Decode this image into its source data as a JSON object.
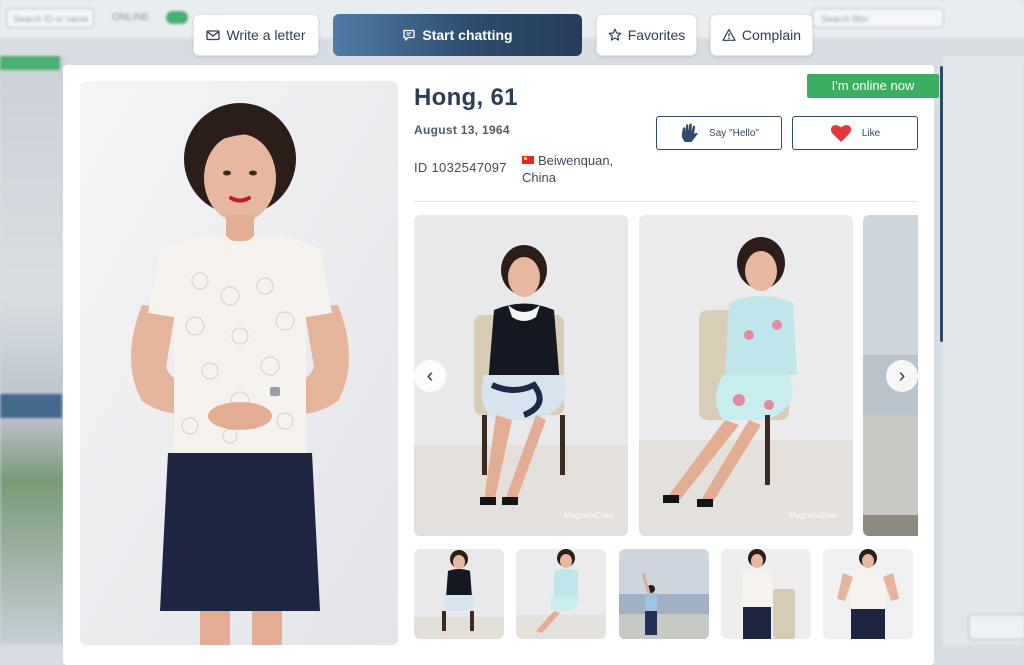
{
  "background": {
    "search_placeholder": "Search ID or name",
    "online_label": "ONLINE",
    "search_right_placeholder": "Search filter"
  },
  "actions": {
    "write_letter": "Write a letter",
    "start_chatting": "Start chatting",
    "favorites": "Favorites",
    "complain": "Complain"
  },
  "profile": {
    "online_status": "I'm online now",
    "name_age": "Hong, 61",
    "birth_date": "August 13, 1964",
    "id_text": "ID 1032547097",
    "location": "Beiwenquan, China",
    "say_hello": "Say \"Hello\"",
    "like": "Like"
  },
  "gallery": {
    "watermark": "MagnoliaDate",
    "thumbnails": 5
  },
  "colors": {
    "accent_navy": "#2f4a6a",
    "online_green": "#3cae62",
    "like_red": "#e5383b"
  }
}
